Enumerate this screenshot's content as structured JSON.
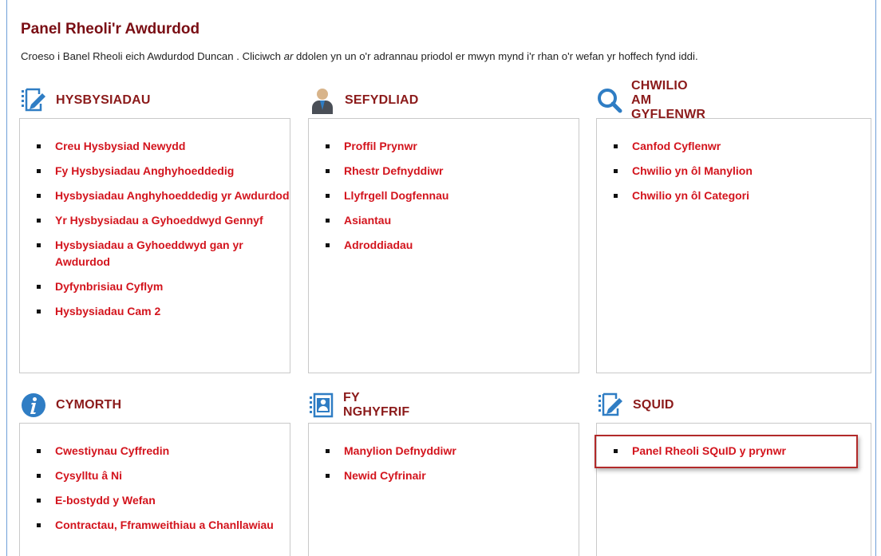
{
  "page": {
    "title": "Panel Rheoli'r Awdurdod",
    "intro_before": "Croeso i Banel Rheoli eich Awdurdod Duncan . Cliciwch ",
    "intro_em": "ar",
    "intro_after": " ddolen yn un o'r adrannau priodol er mwyn mynd i'r rhan o'r wefan yr hoffech fynd iddi."
  },
  "sections": {
    "hysbysiadau": {
      "title": "HYSBYSIADAU",
      "icon": "edit-list-icon",
      "links": [
        "Creu Hysbysiad Newydd",
        "Fy Hysbysiadau Anghyhoeddedig",
        "Hysbysiadau Anghyhoeddedig yr Awdurdod",
        "Yr Hysbysiadau a Gyhoeddwyd Gennyf",
        "Hysbysiadau a Gyhoeddwyd gan yr Awdurdod",
        "Dyfynbrisiau Cyflym",
        "Hysbysiadau Cam 2"
      ]
    },
    "sefydliad": {
      "title": "SEFYDLIAD",
      "icon": "person-icon",
      "links": [
        "Proffil Prynwr",
        "Rhestr Defnyddiwr",
        "Llyfrgell Dogfennau",
        "Asiantau",
        "Adroddiadau"
      ]
    },
    "chwilio": {
      "title": "CHWILIO AM GYFLENWR",
      "icon": "magnifier-icon",
      "links": [
        "Canfod Cyflenwr",
        "Chwilio yn ôl Manylion",
        "Chwilio yn ôl Categori"
      ]
    },
    "cymorth": {
      "title": "CYMORTH",
      "icon": "info-icon",
      "links": [
        "Cwestiynau Cyffredin",
        "Cysylltu â Ni",
        "E-bostydd y Wefan",
        "Contractau, Fframweithiau a Chanllawiau"
      ]
    },
    "fy_nghyfrif": {
      "title": "FY NGHYFRIF",
      "icon": "account-card-icon",
      "links": [
        "Manylion Defnyddiwr",
        "Newid Cyfrinair"
      ]
    },
    "squid": {
      "title": "SQUID",
      "icon": "edit-list-icon",
      "links": [
        "Panel Rheoli SQuID y prynwr"
      ]
    }
  },
  "colors": {
    "heading": "#7a0e14",
    "link": "#d3141d",
    "icon_blue": "#2f7dc4",
    "highlight": "#b22a2a"
  }
}
